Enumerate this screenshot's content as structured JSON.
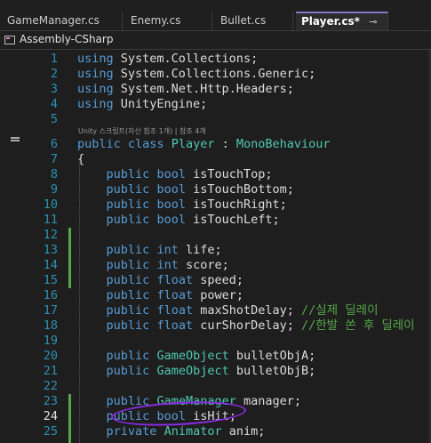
{
  "tabs": [
    {
      "label": "GameManager.cs",
      "active": false
    },
    {
      "label": "Enemy.cs",
      "active": false
    },
    {
      "label": "Bullet.cs",
      "active": false
    },
    {
      "label": "Player.cs*",
      "active": true,
      "pin": "⊸",
      "close": "×"
    }
  ],
  "project": {
    "label": "Assembly-CSharp"
  },
  "hint_text": "Unity 스크립트(자산 참조 1개) | 참조 4개",
  "colors": {
    "keyword": "#569cd6",
    "type": "#4ec9b0",
    "comment": "#57a64a",
    "line_number": "#2b91af",
    "annotation": "#8a2be2",
    "active_tab_accent": "#8a74c9"
  },
  "lines": [
    {
      "n": "1",
      "tokens": [
        [
          "kw",
          "using"
        ],
        [
          "ns",
          " System.Collections;"
        ]
      ]
    },
    {
      "n": "2",
      "tokens": [
        [
          "kw",
          "using"
        ],
        [
          "ns",
          " System.Collections.Generic;"
        ]
      ]
    },
    {
      "n": "3",
      "tokens": [
        [
          "kw",
          "using"
        ],
        [
          "ns",
          " System.Net.Http.Headers;"
        ]
      ]
    },
    {
      "n": "4",
      "tokens": [
        [
          "kw",
          "using"
        ],
        [
          "ns",
          " UnityEngine;"
        ]
      ]
    },
    {
      "n": "5",
      "tokens": []
    },
    {
      "n": "6",
      "tokens": [
        [
          "kw",
          "public"
        ],
        [
          "ns",
          " "
        ],
        [
          "kw",
          "class"
        ],
        [
          "ns",
          " "
        ],
        [
          "ty",
          "Player"
        ],
        [
          "ns",
          " : "
        ],
        [
          "ty",
          "MonoBehaviour"
        ]
      ]
    },
    {
      "n": "7",
      "tokens": [
        [
          "ns",
          "{"
        ]
      ]
    },
    {
      "n": "8",
      "tokens": [
        [
          "ns",
          "    "
        ],
        [
          "kw",
          "public"
        ],
        [
          "ns",
          " "
        ],
        [
          "kw",
          "bool"
        ],
        [
          "ns",
          " isTouchTop;"
        ]
      ]
    },
    {
      "n": "9",
      "tokens": [
        [
          "ns",
          "    "
        ],
        [
          "kw",
          "public"
        ],
        [
          "ns",
          " "
        ],
        [
          "kw",
          "bool"
        ],
        [
          "ns",
          " isTouchBottom;"
        ]
      ]
    },
    {
      "n": "10",
      "tokens": [
        [
          "ns",
          "    "
        ],
        [
          "kw",
          "public"
        ],
        [
          "ns",
          " "
        ],
        [
          "kw",
          "bool"
        ],
        [
          "ns",
          " isTouchRight;"
        ]
      ]
    },
    {
      "n": "11",
      "tokens": [
        [
          "ns",
          "    "
        ],
        [
          "kw",
          "public"
        ],
        [
          "ns",
          " "
        ],
        [
          "kw",
          "bool"
        ],
        [
          "ns",
          " isTouchLeft;"
        ]
      ]
    },
    {
      "n": "12",
      "tokens": []
    },
    {
      "n": "13",
      "tokens": [
        [
          "ns",
          "    "
        ],
        [
          "kw",
          "public"
        ],
        [
          "ns",
          " "
        ],
        [
          "kw",
          "int"
        ],
        [
          "ns",
          " life;"
        ]
      ]
    },
    {
      "n": "14",
      "tokens": [
        [
          "ns",
          "    "
        ],
        [
          "kw",
          "public"
        ],
        [
          "ns",
          " "
        ],
        [
          "kw",
          "int"
        ],
        [
          "ns",
          " score;"
        ]
      ]
    },
    {
      "n": "15",
      "tokens": [
        [
          "ns",
          "    "
        ],
        [
          "kw",
          "public"
        ],
        [
          "ns",
          " "
        ],
        [
          "kw",
          "float"
        ],
        [
          "ns",
          " speed;"
        ]
      ]
    },
    {
      "n": "16",
      "tokens": [
        [
          "ns",
          "    "
        ],
        [
          "kw",
          "public"
        ],
        [
          "ns",
          " "
        ],
        [
          "kw",
          "float"
        ],
        [
          "ns",
          " power;"
        ]
      ]
    },
    {
      "n": "17",
      "tokens": [
        [
          "ns",
          "    "
        ],
        [
          "kw",
          "public"
        ],
        [
          "ns",
          " "
        ],
        [
          "kw",
          "float"
        ],
        [
          "ns",
          " maxShotDelay; "
        ],
        [
          "cm",
          "//실제 딜레이"
        ]
      ]
    },
    {
      "n": "18",
      "tokens": [
        [
          "ns",
          "    "
        ],
        [
          "kw",
          "public"
        ],
        [
          "ns",
          " "
        ],
        [
          "kw",
          "float"
        ],
        [
          "ns",
          " curShorDelay; "
        ],
        [
          "cm",
          "//한발 쏜 후 딜레이"
        ]
      ]
    },
    {
      "n": "19",
      "tokens": []
    },
    {
      "n": "20",
      "tokens": [
        [
          "ns",
          "    "
        ],
        [
          "kw",
          "public"
        ],
        [
          "ns",
          " "
        ],
        [
          "ty",
          "GameObject"
        ],
        [
          "ns",
          " bulletObjA;"
        ]
      ]
    },
    {
      "n": "21",
      "tokens": [
        [
          "ns",
          "    "
        ],
        [
          "kw",
          "public"
        ],
        [
          "ns",
          " "
        ],
        [
          "ty",
          "GameObject"
        ],
        [
          "ns",
          " bulletObjB;"
        ]
      ]
    },
    {
      "n": "22",
      "tokens": []
    },
    {
      "n": "23",
      "tokens": [
        [
          "ns",
          "    "
        ],
        [
          "kw",
          "public"
        ],
        [
          "ns",
          " "
        ],
        [
          "ty",
          "GameManager"
        ],
        [
          "ns",
          " manager;"
        ]
      ]
    },
    {
      "n": "24",
      "tokens": [
        [
          "ns",
          "    "
        ],
        [
          "kw",
          "public"
        ],
        [
          "ns",
          " "
        ],
        [
          "kw",
          "bool"
        ],
        [
          "ns",
          " isHit;"
        ]
      ],
      "current": true
    },
    {
      "n": "25",
      "tokens": [
        [
          "ns",
          "    "
        ],
        [
          "kw",
          "private"
        ],
        [
          "ns",
          " "
        ],
        [
          "ty",
          "Animator"
        ],
        [
          "ns",
          " anim;"
        ]
      ]
    }
  ]
}
